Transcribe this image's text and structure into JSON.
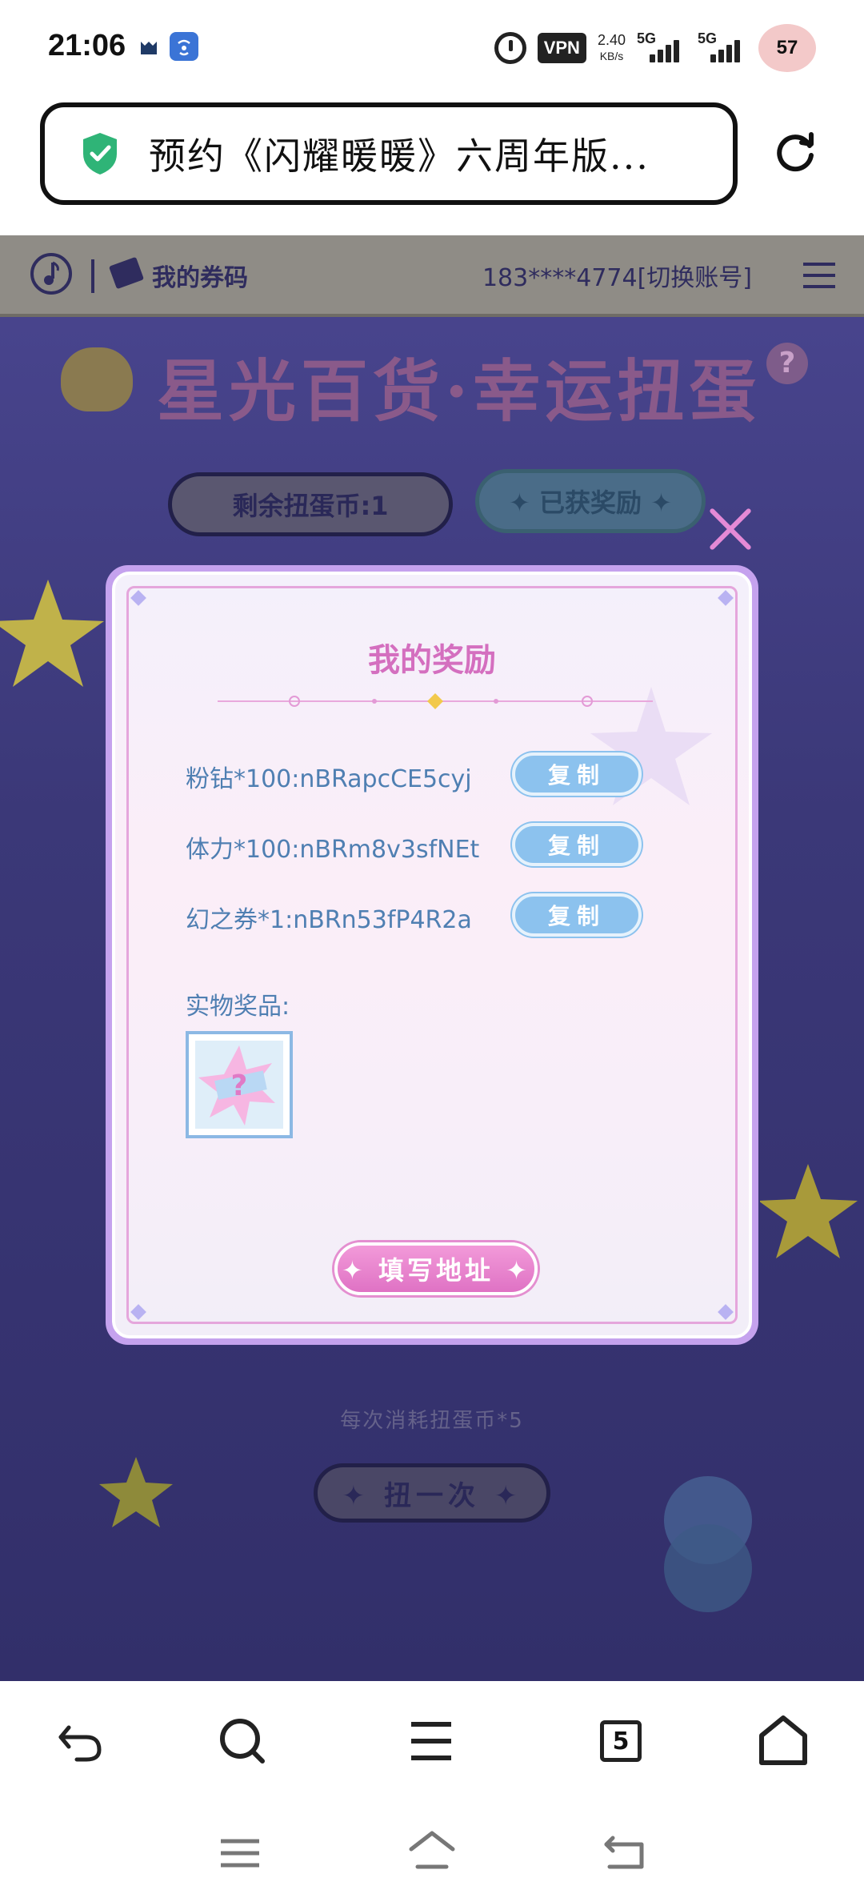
{
  "status_bar": {
    "time": "21:06",
    "vpn": "VPN",
    "speed_value": "2.40",
    "speed_unit": "KB/s",
    "sim1": "5G",
    "sim2": "5G",
    "battery": "57"
  },
  "browser": {
    "page_title": "预约《闪耀暖暖》六周年版...",
    "tab_count": "5"
  },
  "web": {
    "top_bar": {
      "coupon_label": "我的券码",
      "account": "183****4774[切换账号]"
    },
    "title": "星光百货·幸运扭蛋",
    "help": "?",
    "coins_label": "剩余扭蛋币:1",
    "awards_label": "✦ 已获奖励 ✦",
    "consume_text": "每次消耗扭蛋币*5",
    "spin_button": "✦ 扭一次 ✦"
  },
  "modal": {
    "title": "我的奖励",
    "rewards": [
      {
        "label": "粉钻*100:nBRapcCE5cyj",
        "button": "复制"
      },
      {
        "label": "体力*100:nBRm8v3sfNEt",
        "button": "复制"
      },
      {
        "label": "幻之券*1:nBRn53fP4R2a",
        "button": "复制"
      }
    ],
    "physical_label": "实物奖品:",
    "address_button": "✦ 填写地址 ✦"
  },
  "colors": {
    "accent_pink": "#d46fbf",
    "copy_blue": "#8cc2ee",
    "web_bg": "#3e3a78"
  }
}
